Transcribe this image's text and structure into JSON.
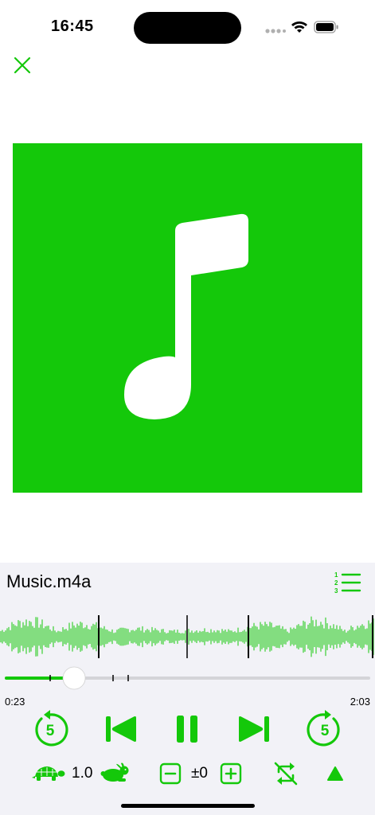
{
  "status_bar": {
    "time": "16:45",
    "signal_icon": "cellular-dots-icon",
    "wifi_icon": "wifi-icon",
    "battery_icon": "battery-icon"
  },
  "header": {
    "close_icon": "close-icon"
  },
  "artwork": {
    "icon": "music-note-icon",
    "background": "#14c80a"
  },
  "player": {
    "title": "Music.m4a",
    "queue_icon": "numbered-list-icon",
    "progress": {
      "elapsed": "0:23",
      "total": "2:03",
      "fraction": 0.187
    },
    "controls": {
      "skip_back_seconds": "5",
      "skip_forward_seconds": "5",
      "previous_icon": "skip-back-icon",
      "play_pause_icon": "pause-icon",
      "next_icon": "skip-forward-icon"
    },
    "speed": {
      "value": "1.0",
      "slow_icon": "turtle-icon",
      "fast_icon": "rabbit-icon"
    },
    "pitch": {
      "value": "±0",
      "minus_icon": "minus-square-icon",
      "plus_icon": "plus-square-icon"
    },
    "repeat_icon": "repeat-off-icon",
    "expand_icon": "triangle-up-icon"
  },
  "colors": {
    "accent": "#14c80a",
    "panel": "#f2f2f7"
  }
}
